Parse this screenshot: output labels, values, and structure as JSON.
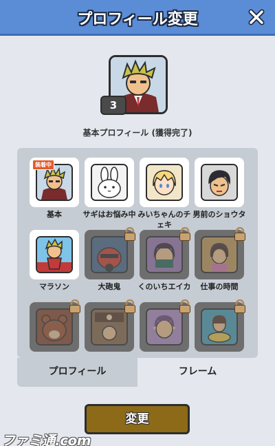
{
  "header": {
    "title": "プロフィール変更"
  },
  "current": {
    "level": "3"
  },
  "subtitle": "基本プロフィール (獲得完了)",
  "items": [
    {
      "label": "基本",
      "equipped_badge": "装着中",
      "locked": false,
      "bg": "#c9d8e6",
      "icon": "businessman-portrait-icon"
    },
    {
      "label": "サギはお悩み中",
      "locked": false,
      "bg": "#f3f3f3",
      "icon": "white-rabbit-icon"
    },
    {
      "label": "みいちゃんのチェキ",
      "locked": false,
      "bg": "#f2e6c9",
      "icon": "blonde-girl-icon"
    },
    {
      "label": "男前のショウタ",
      "locked": false,
      "bg": "#d8d8d8",
      "icon": "dark-hair-boy-icon"
    },
    {
      "label": "マラソン",
      "locked": false,
      "bg": "#7dc4e8",
      "icon": "runner-icon"
    },
    {
      "label": "大砲鬼",
      "locked": true,
      "bg": "#4a6b8a",
      "icon": "cannon-ogre-icon"
    },
    {
      "label": "くのいちエイカ",
      "locked": true,
      "bg": "#9c7ab0",
      "icon": "kunoichi-icon"
    },
    {
      "label": "仕事の時間",
      "locked": true,
      "bg": "#c29a5a",
      "icon": "office-girl-icon"
    },
    {
      "label": "",
      "locked": true,
      "bg": "#8a4a30",
      "icon": "bear-icon"
    },
    {
      "label": "",
      "locked": true,
      "bg": "#8a6a4a",
      "icon": "shop-scene-icon"
    },
    {
      "label": "",
      "locked": true,
      "bg": "#b08ec0",
      "icon": "elf-girl-icon"
    },
    {
      "label": "",
      "locked": true,
      "bg": "#4aa0b8",
      "icon": "girl-on-float-icon"
    }
  ],
  "tabs": {
    "profile": "プロフィール",
    "frame": "フレーム"
  },
  "change_button": "変更",
  "watermark": "ファミ通.com"
}
